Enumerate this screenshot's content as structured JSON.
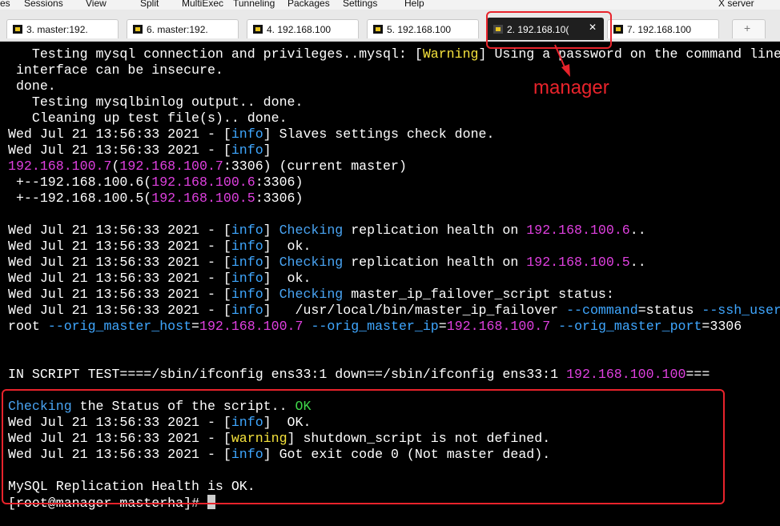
{
  "menu": [
    "es",
    "Sessions",
    "View",
    "Split",
    "MultiExec",
    "Tunneling",
    "Packages",
    "Settings",
    "Help",
    "X server"
  ],
  "tabs": [
    {
      "label": "3. master:192.",
      "icon": "terminal-session-icon",
      "active": false
    },
    {
      "label": "6. master:192.",
      "icon": "terminal-session-icon",
      "active": false
    },
    {
      "label": "4. 192.168.100",
      "icon": "terminal-session-icon",
      "active": false
    },
    {
      "label": "5. 192.168.100",
      "icon": "terminal-session-icon",
      "active": false
    },
    {
      "label": "2. 192.168.10(",
      "icon": "terminal-session-icon",
      "active": true,
      "close": "✕"
    },
    {
      "label": "7. 192.168.100",
      "icon": "terminal-session-icon",
      "active": false
    }
  ],
  "new_tab_label": "+",
  "annotation": "manager",
  "colors": {
    "warning": "#f5e23c",
    "info": "#3fa7ff",
    "ip": "#e040e0",
    "ok": "#3fd84a",
    "highlight": "#e8232b",
    "terminal_bg": "#000000"
  },
  "terminal": [
    [
      {
        "t": "   Testing mysql connection and privileges..mysql: ["
      },
      {
        "t": "Warning",
        "c": "warn"
      },
      {
        "t": "] Using a password on the command line"
      }
    ],
    [
      {
        "t": " interface can be insecure."
      }
    ],
    [
      {
        "t": " done."
      }
    ],
    [
      {
        "t": "   Testing mysqlbinlog output.. done."
      }
    ],
    [
      {
        "t": "   Cleaning up test file(s).. done."
      }
    ],
    [
      {
        "t": "Wed Jul 21 13:56:33 2021 - ["
      },
      {
        "t": "info",
        "c": "info"
      },
      {
        "t": "] Slaves settings check done."
      }
    ],
    [
      {
        "t": "Wed Jul 21 13:56:33 2021 - ["
      },
      {
        "t": "info",
        "c": "info"
      },
      {
        "t": "]"
      }
    ],
    [
      {
        "t": "192.168.100.7",
        "c": "ip"
      },
      {
        "t": "("
      },
      {
        "t": "192.168.100.7",
        "c": "ip"
      },
      {
        "t": ":3306) (current master)"
      }
    ],
    [
      {
        "t": " +--192.168.100.6("
      },
      {
        "t": "192.168.100.6",
        "c": "ip"
      },
      {
        "t": ":3306)"
      }
    ],
    [
      {
        "t": " +--192.168.100.5("
      },
      {
        "t": "192.168.100.5",
        "c": "ip"
      },
      {
        "t": ":3306)"
      }
    ],
    [],
    [
      {
        "t": "Wed Jul 21 13:56:33 2021 - ["
      },
      {
        "t": "info",
        "c": "info"
      },
      {
        "t": "] "
      },
      {
        "t": "Checking",
        "c": "check"
      },
      {
        "t": " replication health on "
      },
      {
        "t": "192.168.100.6",
        "c": "ip"
      },
      {
        "t": ".."
      }
    ],
    [
      {
        "t": "Wed Jul 21 13:56:33 2021 - ["
      },
      {
        "t": "info",
        "c": "info"
      },
      {
        "t": "]  ok."
      }
    ],
    [
      {
        "t": "Wed Jul 21 13:56:33 2021 - ["
      },
      {
        "t": "info",
        "c": "info"
      },
      {
        "t": "] "
      },
      {
        "t": "Checking",
        "c": "check"
      },
      {
        "t": " replication health on "
      },
      {
        "t": "192.168.100.5",
        "c": "ip"
      },
      {
        "t": ".."
      }
    ],
    [
      {
        "t": "Wed Jul 21 13:56:33 2021 - ["
      },
      {
        "t": "info",
        "c": "info"
      },
      {
        "t": "]  ok."
      }
    ],
    [
      {
        "t": "Wed Jul 21 13:56:33 2021 - ["
      },
      {
        "t": "info",
        "c": "info"
      },
      {
        "t": "] "
      },
      {
        "t": "Checking",
        "c": "check"
      },
      {
        "t": " master_ip_failover_script status:"
      }
    ],
    [
      {
        "t": "Wed Jul 21 13:56:33 2021 - ["
      },
      {
        "t": "info",
        "c": "info"
      },
      {
        "t": "]   /usr/local/bin/master_ip_failover "
      },
      {
        "t": "--command",
        "c": "opt"
      },
      {
        "t": "=status "
      },
      {
        "t": "--ssh_user",
        "c": "opt"
      },
      {
        "t": "="
      }
    ],
    [
      {
        "t": "root "
      },
      {
        "t": "--orig_master_host",
        "c": "opt"
      },
      {
        "t": "="
      },
      {
        "t": "192.168.100.7",
        "c": "ip"
      },
      {
        "t": " "
      },
      {
        "t": "--orig_master_ip",
        "c": "opt"
      },
      {
        "t": "="
      },
      {
        "t": "192.168.100.7",
        "c": "ip"
      },
      {
        "t": " "
      },
      {
        "t": "--orig_master_port",
        "c": "opt"
      },
      {
        "t": "=3306"
      }
    ],
    [],
    [],
    [
      {
        "t": "IN SCRIPT TEST====/sbin/ifconfig ens33:1 down==/sbin/ifconfig ens33:1 "
      },
      {
        "t": "192.168.100.100",
        "c": "ip"
      },
      {
        "t": "==="
      }
    ],
    [],
    [
      {
        "t": "Checking",
        "c": "check"
      },
      {
        "t": " the Status of the script.. "
      },
      {
        "t": "OK",
        "c": "ok"
      }
    ],
    [
      {
        "t": "Wed Jul 21 13:56:33 2021 - ["
      },
      {
        "t": "info",
        "c": "info"
      },
      {
        "t": "]  OK."
      }
    ],
    [
      {
        "t": "Wed Jul 21 13:56:33 2021 - ["
      },
      {
        "t": "warning",
        "c": "warn"
      },
      {
        "t": "] shutdown_script is not defined."
      }
    ],
    [
      {
        "t": "Wed Jul 21 13:56:33 2021 - ["
      },
      {
        "t": "info",
        "c": "info"
      },
      {
        "t": "] Got exit code 0 (Not master dead)."
      }
    ],
    [],
    [
      {
        "t": "MySQL Replication Health is OK."
      }
    ],
    [
      {
        "t": "[root@manager masterha]# "
      }
    ]
  ]
}
